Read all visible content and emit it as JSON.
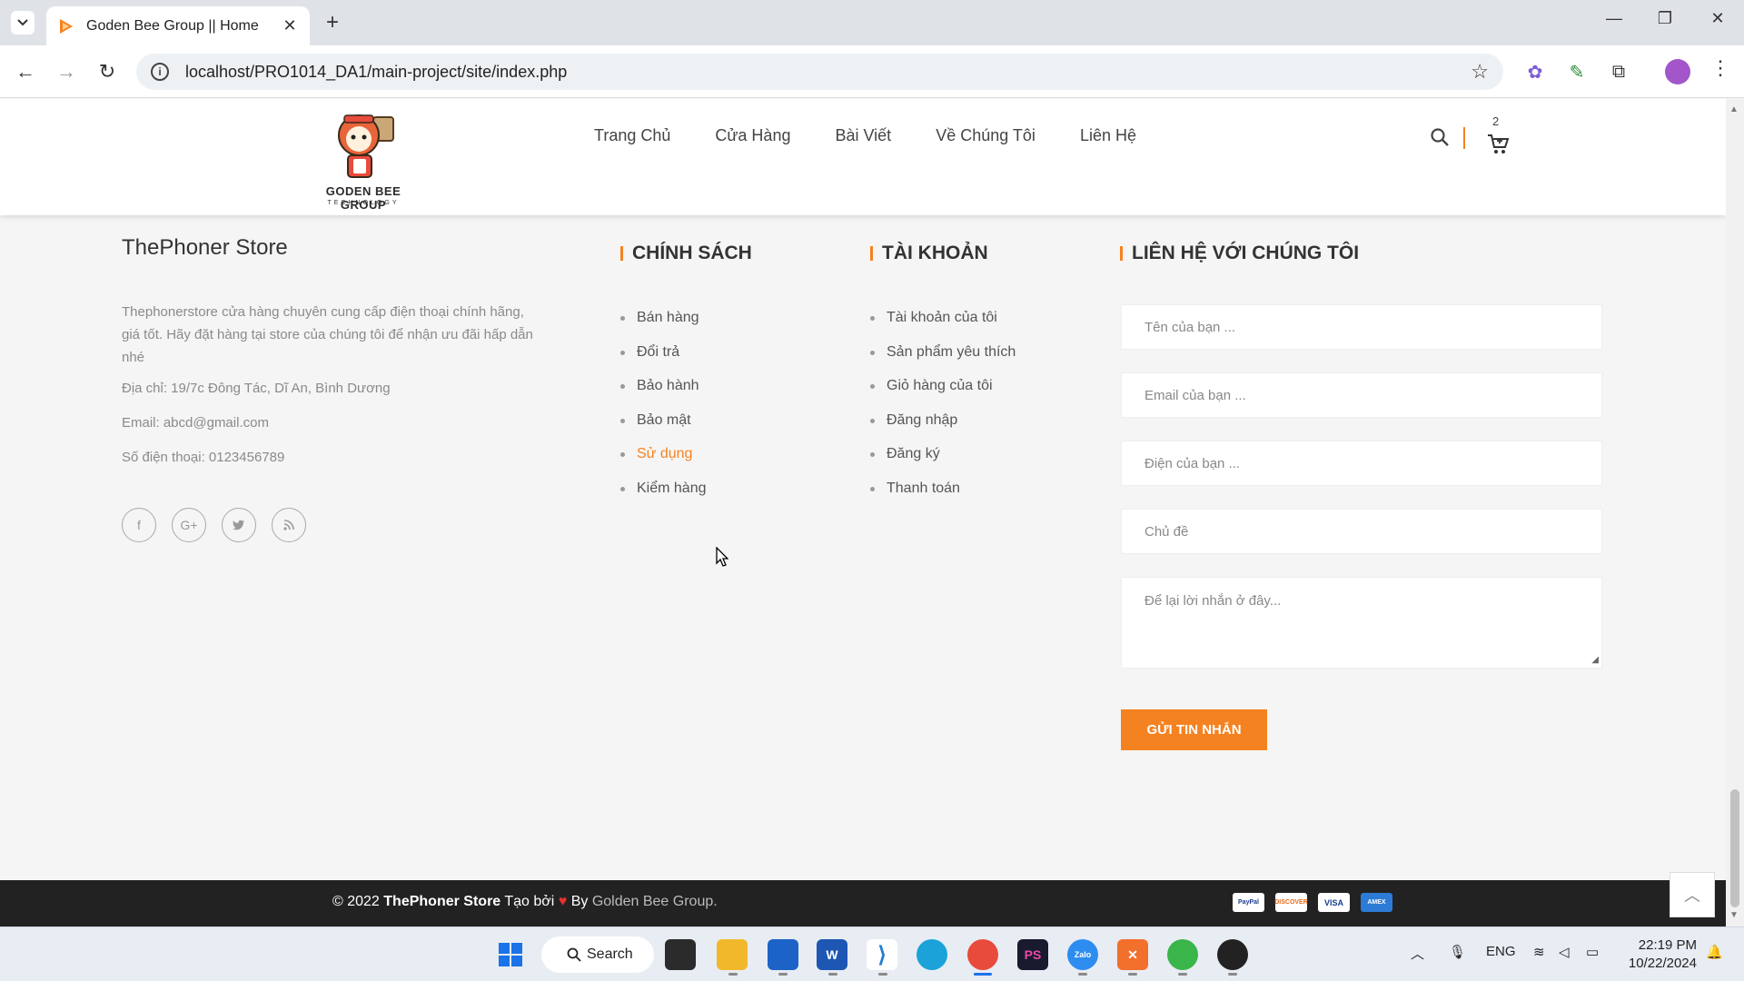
{
  "browser": {
    "tab_title": "Goden Bee Group || Home",
    "url": "localhost/PRO1014_DA1/main-project/site/index.php"
  },
  "header": {
    "logo_text": "GODEN BEE GROUP",
    "logo_sub": "TECHNOLOGY",
    "nav": [
      "Trang Chủ",
      "Cửa Hàng",
      "Bài Viết",
      "Về Chúng Tôi",
      "Liên Hệ"
    ],
    "cart_count": "2"
  },
  "footer": {
    "store_name": "ThePhoner Store",
    "description": "Thephonerstore cửa hàng chuyên cung cấp điện thoại chính hãng, giá tốt. Hãy đặt hàng tại store của chúng tôi để nhận ưu đãi hấp dẫn nhé",
    "address": "Địa chỉ: 19/7c Đông Tác, Dĩ An, Bình Dương",
    "email": "Email: abcd@gmail.com",
    "phone": "Số điện thoại: 0123456789",
    "social_icons": [
      "facebook-icon",
      "google-plus-icon",
      "twitter-icon",
      "rss-icon"
    ],
    "policy": {
      "title": "CHÍNH SÁCH",
      "items": [
        "Bán hàng",
        "Đổi trả",
        "Bảo hành",
        "Bảo mật",
        "Sử dụng",
        "Kiểm hàng"
      ]
    },
    "account": {
      "title": "TÀI KHOẢN",
      "items": [
        "Tài khoản của tôi",
        "Sản phẩm yêu thích",
        "Giỏ hàng của tôi",
        "Đăng nhập",
        "Đăng ký",
        "Thanh toán"
      ]
    },
    "contact": {
      "title": "LIÊN HỆ VỚI CHÚNG TÔI",
      "name_placeholder": "Tên của bạn ...",
      "email_placeholder": "Email của bạn ...",
      "phone_placeholder": "Điện của bạn ...",
      "subject_placeholder": "Chủ đề",
      "message_placeholder": "Để lại lời nhắn ở đây...",
      "submit_label": "GỬI TIN NHẮN"
    },
    "copyright": {
      "prefix": "© 2022 ",
      "store": "ThePhoner Store",
      "middle": " Tạo bởi ",
      "heart": "♥",
      "by": " By ",
      "group": "Golden Bee Group."
    },
    "payments": [
      "PayPal",
      "DISCOVER",
      "VISA",
      "AMEX"
    ]
  },
  "taskbar": {
    "search_label": "Search",
    "language": "ENG",
    "time": "22:19 PM",
    "date": "10/22/2024"
  },
  "colors": {
    "accent": "#f58220",
    "footer_bar": "#222222"
  }
}
